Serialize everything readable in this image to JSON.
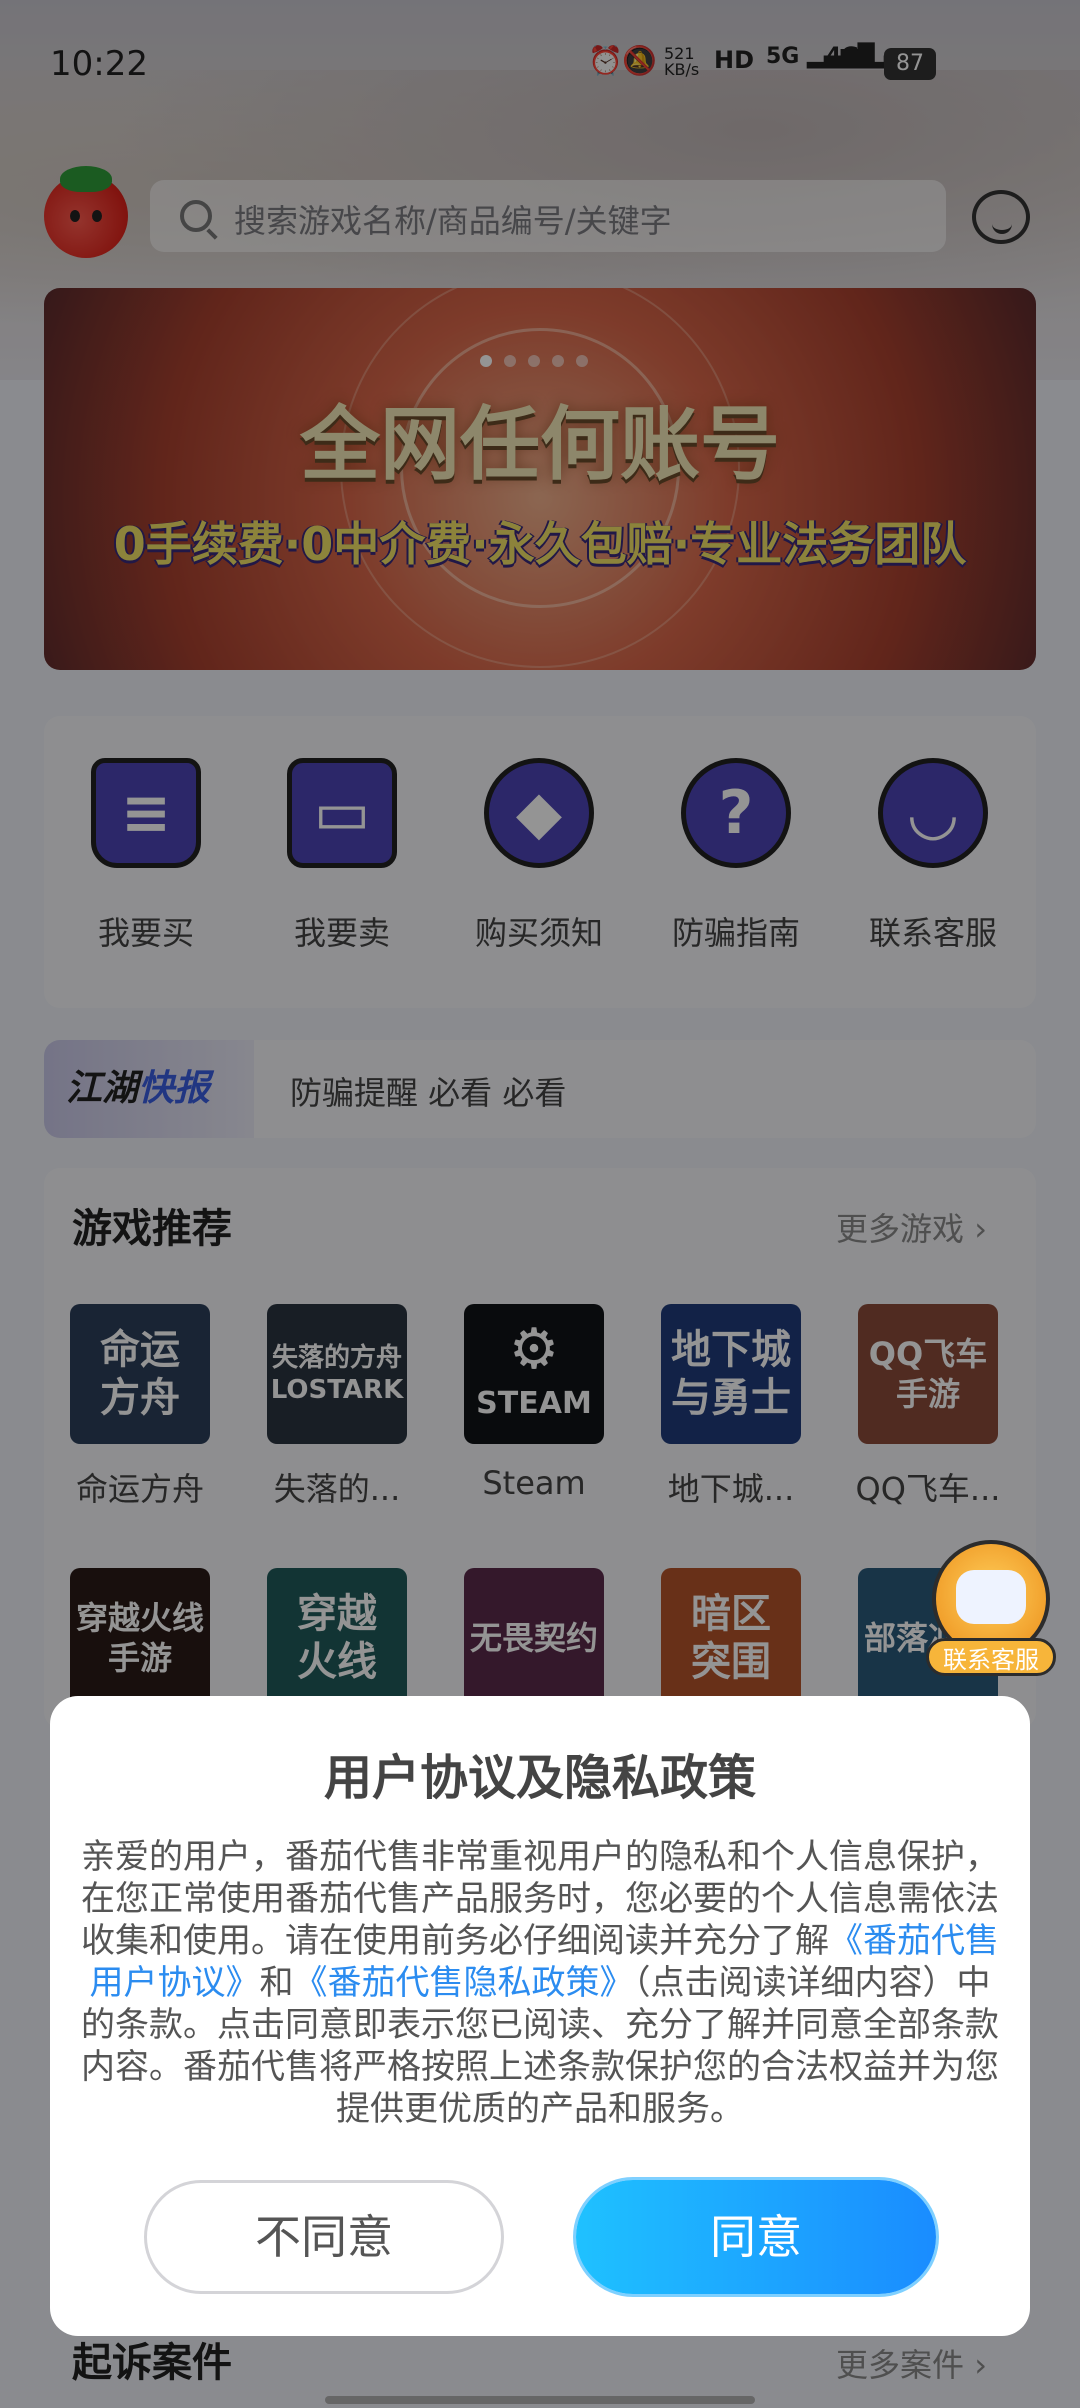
{
  "status_bar": {
    "time": "10:22",
    "net_speed": "521 KB/s",
    "icons": "⏰ 🔕 HD 5G 4G",
    "battery": "87"
  },
  "search": {
    "placeholder": "搜索游戏名称/商品编号/关键字"
  },
  "banner": {
    "title": "全网任何账号",
    "subtitle": "0手续费·0中介费·永久包赔·专业法务团队"
  },
  "quick_entries": [
    {
      "label": "我要买",
      "icon": "shopping-basket-icon"
    },
    {
      "label": "我要卖",
      "icon": "storefront-icon"
    },
    {
      "label": "购买须知",
      "icon": "diamond-notice-icon"
    },
    {
      "label": "防骗指南",
      "icon": "question-icon"
    },
    {
      "label": "联系客服",
      "icon": "chat-bubble-icon"
    }
  ],
  "news": {
    "tag_part1": "江湖",
    "tag_part2": "快报",
    "text": "防骗提醒 必看 必看"
  },
  "games_section": {
    "title": "游戏推荐",
    "more": "更多游戏",
    "row1": [
      {
        "tile": "命运\n方舟",
        "name": "命运方舟",
        "color": "#2c3e5a"
      },
      {
        "tile": "失落的方舟\nLOSTARK",
        "name": "失落的...",
        "color": "#2a3440"
      },
      {
        "tile": "STEAM",
        "name": "Steam",
        "color": "#111318"
      },
      {
        "tile": "地下城\n与勇士",
        "name": "地下城...",
        "color": "#1f3c7a"
      },
      {
        "tile": "QQ飞车\n手游",
        "name": "QQ飞车...",
        "color": "#8a4a3a"
      }
    ],
    "row2": [
      {
        "tile": "穿越火线\n手游",
        "color": "#2a1a18"
      },
      {
        "tile": "穿越\n火线",
        "color": "#1f5a5a"
      },
      {
        "tile": "无畏契约",
        "color": "#5a2a4a"
      },
      {
        "tile": "暗区\n突围",
        "color": "#b3542a"
      },
      {
        "tile": "部落冲突",
        "color": "#2a5a7a"
      }
    ]
  },
  "floating_service": {
    "label": "联系客服"
  },
  "dialog": {
    "title": "用户协议及隐私政策",
    "text_before": "亲爱的用户，番茄代售非常重视用户的隐私和个人信息保护，在您正常使用番茄代售产品服务时，您必要的个人信息需依法收集和使用。请在使用前务必仔细阅读并充分了解",
    "link_agreement": "《番茄代售用户协议》",
    "text_and": "和",
    "link_privacy": "《番茄代售隐私政策》",
    "text_after": "（点击阅读详细内容）中的条款。点击同意即表示您已阅读、充分了解并同意全部条款内容。番茄代售将严格按照上述条款保护您的合法权益并为您提供更优质的产品和服务。",
    "disagree": "不同意",
    "agree": "同意"
  },
  "lawsuit_section": {
    "title": "起诉案件",
    "more": "更多案件"
  }
}
